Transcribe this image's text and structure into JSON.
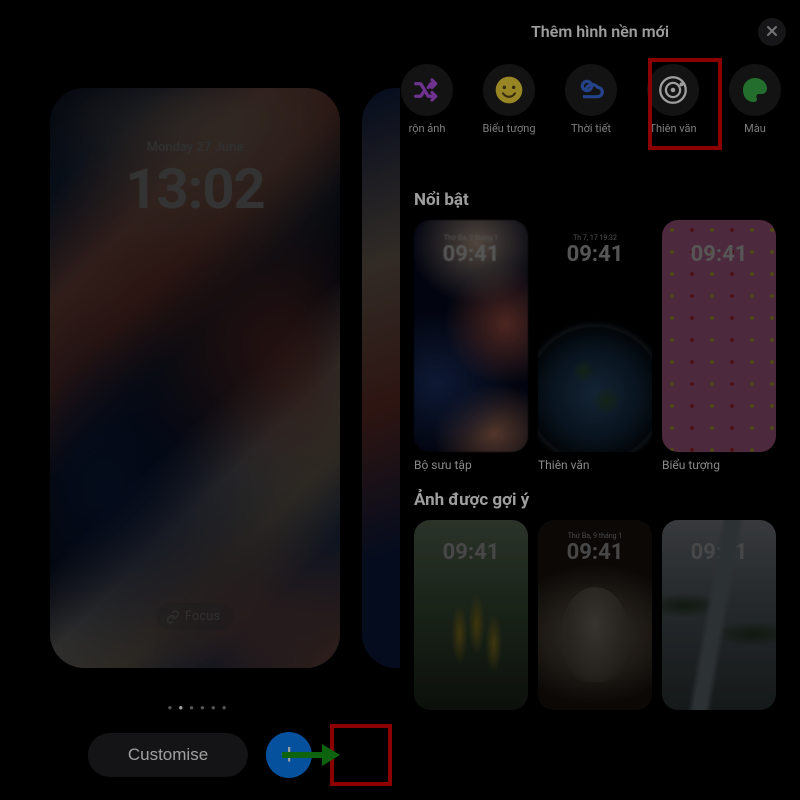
{
  "left": {
    "date": "Monday 27 June",
    "time": "13:02",
    "focus_label": "Focus",
    "customise_label": "Customise"
  },
  "right": {
    "header_title": "Thêm hình nền mới",
    "categories": {
      "shuffle": "rộn ảnh",
      "emoji": "Biểu tượng",
      "weather": "Thời tiết",
      "astronomy": "Thiên văn",
      "color": "Màu"
    },
    "featured": {
      "title": "Nổi bật",
      "items": [
        {
          "date": "Thứ Ba, 9 tháng 1",
          "time": "09:41",
          "label": "Bộ sưu tập"
        },
        {
          "date": "Th 7, 17  19:32",
          "time": "09:41",
          "label": "Thiên văn"
        },
        {
          "date": "",
          "time": "09:41",
          "label": "Biểu tượng"
        }
      ]
    },
    "suggested": {
      "title": "Ảnh được gợi ý",
      "items": [
        {
          "date": "",
          "time": "09:41"
        },
        {
          "date": "Thứ Ba, 9 tháng 1",
          "time": "09:41"
        },
        {
          "date": "",
          "time": "09:41"
        }
      ]
    }
  }
}
